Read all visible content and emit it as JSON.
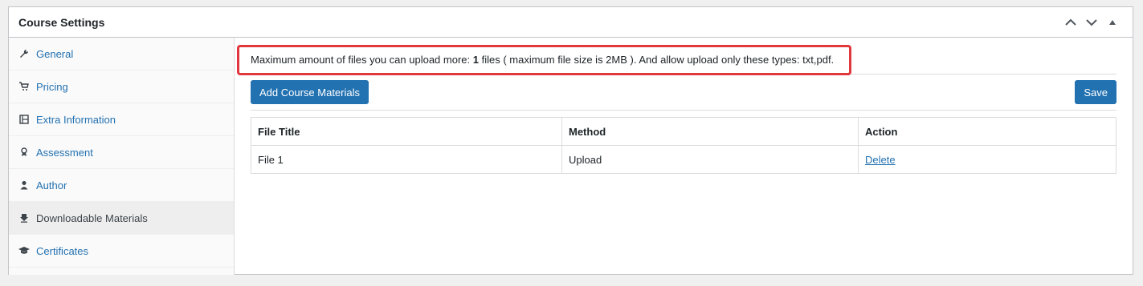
{
  "header": {
    "title": "Course Settings",
    "actions": [
      "chevron-up-icon",
      "chevron-down-icon",
      "triangle-up-icon"
    ]
  },
  "sidebar": {
    "items": [
      {
        "label": "General",
        "icon": "wrench-icon"
      },
      {
        "label": "Pricing",
        "icon": "cart-icon"
      },
      {
        "label": "Extra Information",
        "icon": "film-icon"
      },
      {
        "label": "Assessment",
        "icon": "award-icon"
      },
      {
        "label": "Author",
        "icon": "user-icon"
      },
      {
        "label": "Downloadable Materials",
        "icon": "download-icon",
        "active": true
      },
      {
        "label": "Certificates",
        "icon": "graduation-cap-icon"
      }
    ]
  },
  "notice": {
    "prefix": "Maximum amount of files you can upload more: ",
    "count": "1",
    "suffix": " files ( maximum file size is 2MB ). And allow upload only these types: txt,pdf."
  },
  "toolbar": {
    "add_label": "Add Course Materials",
    "save_label": "Save"
  },
  "table": {
    "headers": [
      "File Title",
      "Method",
      "Action"
    ],
    "rows": [
      {
        "title": "File 1",
        "method": "Upload",
        "action": "Delete"
      }
    ]
  },
  "colors": {
    "accent": "#2271b1",
    "highlight": "#e0383d"
  }
}
